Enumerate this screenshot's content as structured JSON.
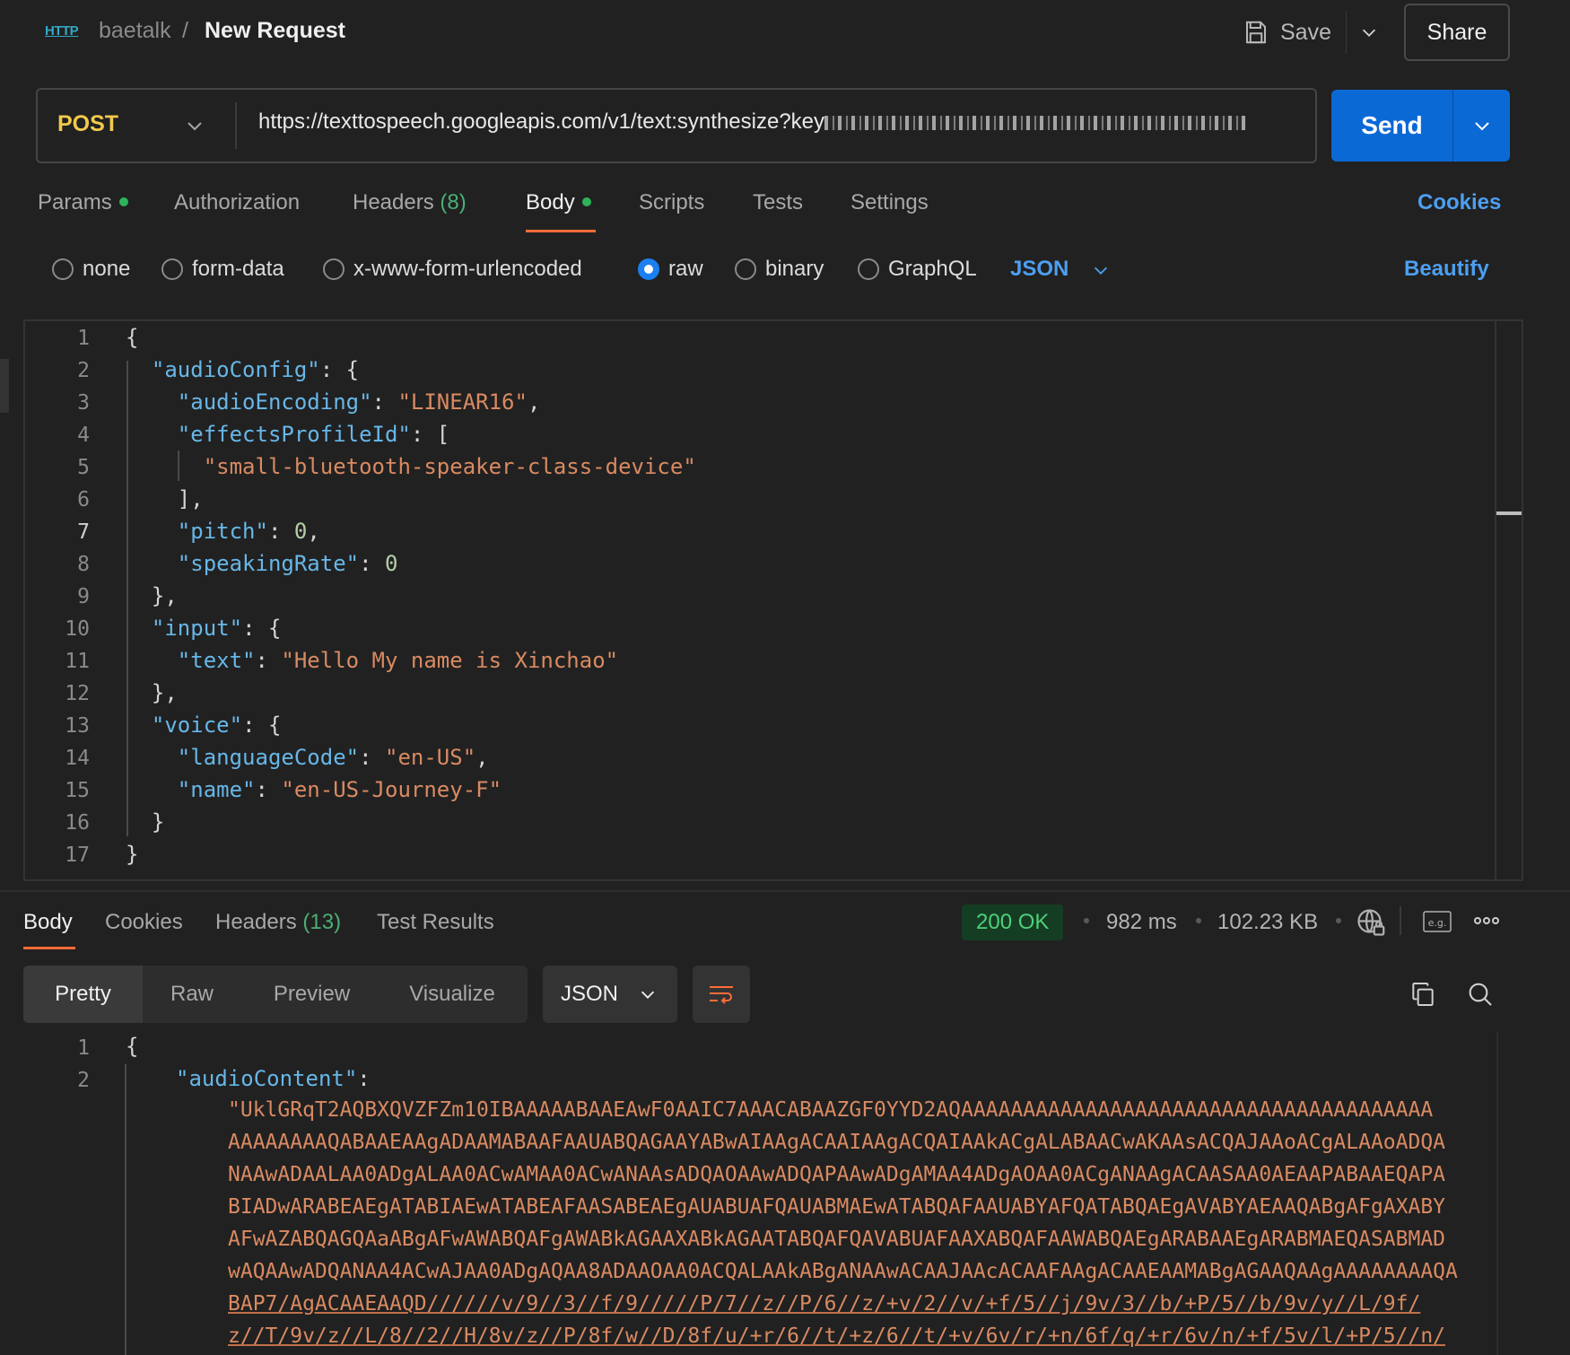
{
  "header": {
    "protocol_badge": "HTTP",
    "workspace": "baetalk",
    "separator": "/",
    "title": "New Request",
    "save_label": "Save",
    "share_label": "Share"
  },
  "request": {
    "method": "POST",
    "url": "https://texttospeech.googleapis.com/v1/text:synthesize?key",
    "send_label": "Send"
  },
  "request_tabs": {
    "params": "Params",
    "authorization": "Authorization",
    "headers": "Headers",
    "headers_count": "(8)",
    "body": "Body",
    "scripts": "Scripts",
    "tests": "Tests",
    "settings": "Settings",
    "cookies": "Cookies"
  },
  "body_types": {
    "none": "none",
    "form_data": "form-data",
    "urlencoded": "x-www-form-urlencoded",
    "raw": "raw",
    "binary": "binary",
    "graphql": "GraphQL",
    "language": "JSON",
    "beautify": "Beautify"
  },
  "editor": {
    "line_numbers": [
      "1",
      "2",
      "3",
      "4",
      "5",
      "6",
      "7",
      "8",
      "9",
      "10",
      "11",
      "12",
      "13",
      "14",
      "15",
      "16",
      "17"
    ],
    "tokens": {
      "audioConfig": "\"audioConfig\"",
      "audioEncoding": "\"audioEncoding\"",
      "linear16": "\"LINEAR16\"",
      "effectsProfileId": "\"effectsProfileId\"",
      "device": "\"small-bluetooth-speaker-class-device\"",
      "pitch": "\"pitch\"",
      "pitch_value": "0",
      "speakingRate": "\"speakingRate\"",
      "speakingRate_value": "0",
      "input": "\"input\"",
      "text": "\"text\"",
      "text_value": "\"Hello My name is Xinchao\"",
      "voice": "\"voice\"",
      "languageCode": "\"languageCode\"",
      "languageCode_value": "\"en-US\"",
      "name": "\"name\"",
      "name_value": "\"en-US-Journey-F\""
    }
  },
  "response": {
    "tabs": {
      "body": "Body",
      "cookies": "Cookies",
      "headers": "Headers",
      "headers_count": "(13)",
      "test_results": "Test Results"
    },
    "status": "200 OK",
    "time": "982 ms",
    "size": "102.23 KB",
    "views": {
      "pretty": "Pretty",
      "raw": "Raw",
      "preview": "Preview",
      "visualize": "Visualize"
    },
    "format": "JSON",
    "line_numbers": [
      "1",
      "2"
    ],
    "key": "\"audioContent\"",
    "content_lines": [
      "\"UklGRqT2AQBXQVZFZm10IBAAAAABAAEAwF0AAIC7AAACABAAZGF0YYD2AQAAAAAAAAAAAAAAAAAAAAAAAAAAAAAAAAAAAAAA",
      "AAAAAAAAQABAAEAAgADAAMABAAFAAUABQAGAAYABwAIAAgACAAIAAgACQAIAAkACgALABAACwAKAAsACQAJAAoACgALAAoADQA",
      "NAAwADAALAA0ADgALAA0ACwAMAA0ACwANAAsADQAOAAwADQAPAAwADgAMAA4ADgAOAA0ACgANAAgACAASAA0AEAAPABAAEQAPA",
      "BIADwARABEAEgATABIAEwATABEAFAASABEAEgAUABUAFQAUABMAEwATABQAFAAUABYAFQATABQAEgAVABYAEAAQABgAFgAXABY",
      "AFwAZABQAGQAaABgAFwAWABQAFgAWABkAGAAXABkAGAATABQAFQAVABUAFAAXABQAFAAWABQAEgARABAAEgARABMAEQASABMAD",
      "wAQAAwADQANAA4ACwAJAA0ADgAQAA8ADAAOAA0ACQALAAkABgANAAwACAAJAAcACAAFAAgACAAEAAMABgAGAAQAAgAAAAAAAAQA",
      "BAP7/AgACAAEAAQD//////v/9//3//f/9/////P/7//z//P/6//z/+v/2//v/+f/5//j/9v/3//b/+P/5//b/9v/y//L/9f/",
      "z//T/9v/z//L/8//2//H/8v/z//P/8f/w//D/8f/u/+r/6//t/+z/6//t/+v/6v/r/+n/6f/q/+r/6v/n/+f/5v/l/+P/5//n/"
    ]
  }
}
